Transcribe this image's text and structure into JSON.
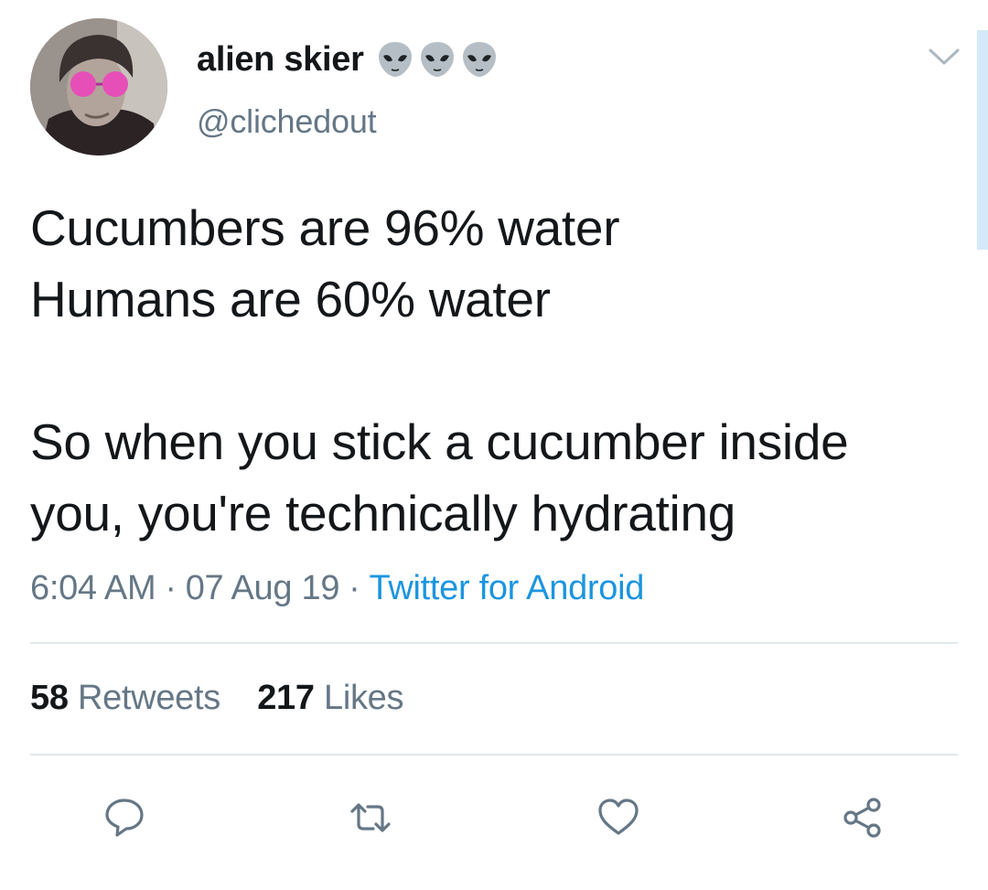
{
  "user": {
    "display_name": "alien skier",
    "name_emojis": [
      "alien-emoji",
      "alien-emoji",
      "alien-emoji"
    ],
    "handle": "@clichedout"
  },
  "tweet": {
    "lines": [
      "Cucumbers are 96% water",
      "Humans are 60% water",
      "",
      "So when you stick a cucumber inside",
      "you, you're technically hydrating"
    ],
    "time": "6:04 AM",
    "date": "07 Aug 19",
    "separator": "·",
    "source": "Twitter for Android"
  },
  "stats": {
    "retweets_count": "58",
    "retweets_label": "Retweets",
    "likes_count": "217",
    "likes_label": "Likes"
  },
  "actions": [
    "reply-icon",
    "retweet-icon",
    "like-icon",
    "share-icon"
  ],
  "colors": {
    "text": "#14171a",
    "secondary": "#657786",
    "link": "#1b95e0",
    "divider": "#e1e8ed",
    "avatar_glasses": "#e64fb8"
  }
}
